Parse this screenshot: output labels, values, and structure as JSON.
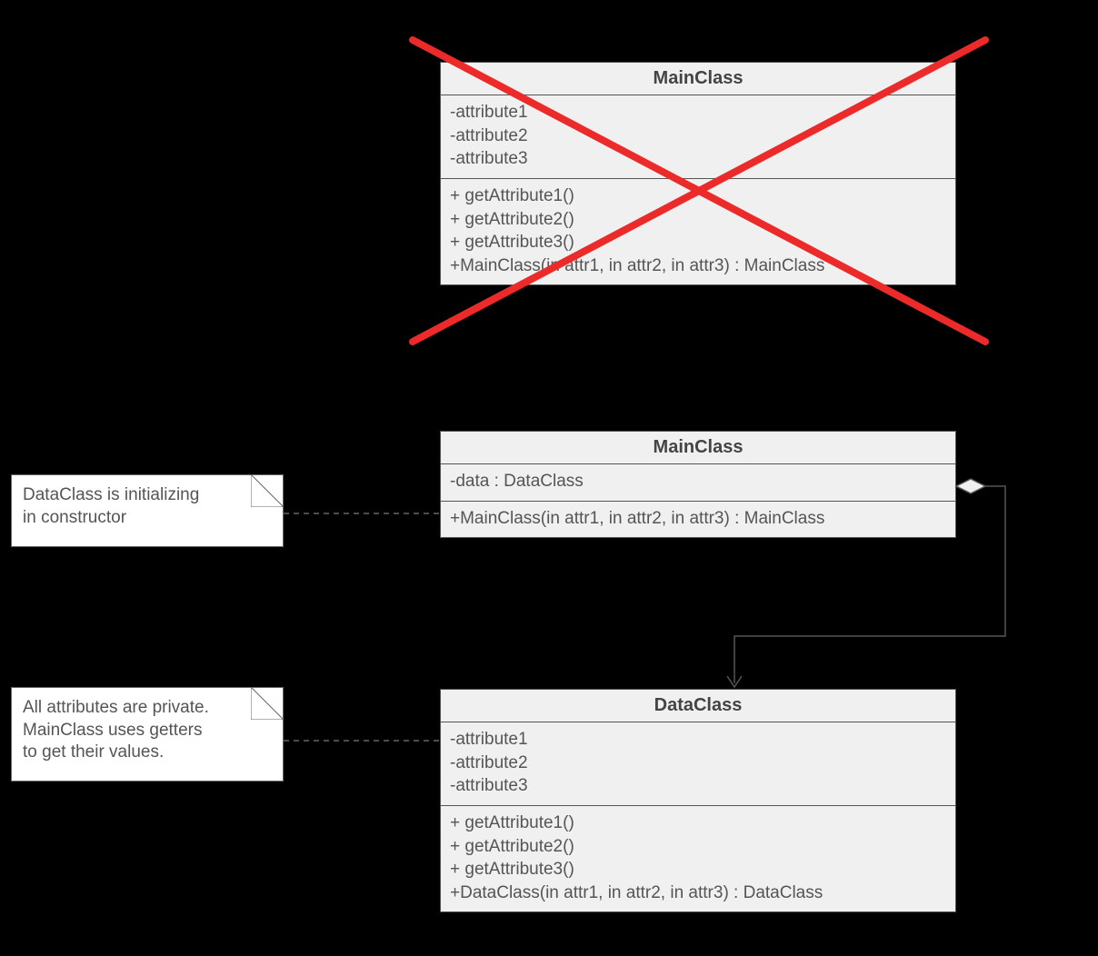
{
  "classes": {
    "top": {
      "name": "MainClass",
      "attributes": [
        "-attribute1",
        "-attribute2",
        "-attribute3"
      ],
      "methods": [
        "+ getAttribute1()",
        "+ getAttribute2()",
        "+ getAttribute3()",
        "+MainClass(in attr1, in attr2, in attr3) : MainClass"
      ]
    },
    "middle": {
      "name": "MainClass",
      "attributes": [
        "-data : DataClass"
      ],
      "methods": [
        "+MainClass(in attr1, in attr2, in attr3) : MainClass"
      ]
    },
    "bottom": {
      "name": "DataClass",
      "attributes": [
        "-attribute1",
        "-attribute2",
        "-attribute3"
      ],
      "methods": [
        "+ getAttribute1()",
        "+ getAttribute2()",
        "+ getAttribute3()",
        "+DataClass(in attr1, in attr2, in attr3) : DataClass"
      ]
    }
  },
  "notes": {
    "n1": {
      "line1": "DataClass is initializing",
      "line2": "in constructor"
    },
    "n2": {
      "line1": "All attributes are private.",
      "line2": "MainClass uses getters",
      "line3": "to get their values."
    }
  }
}
